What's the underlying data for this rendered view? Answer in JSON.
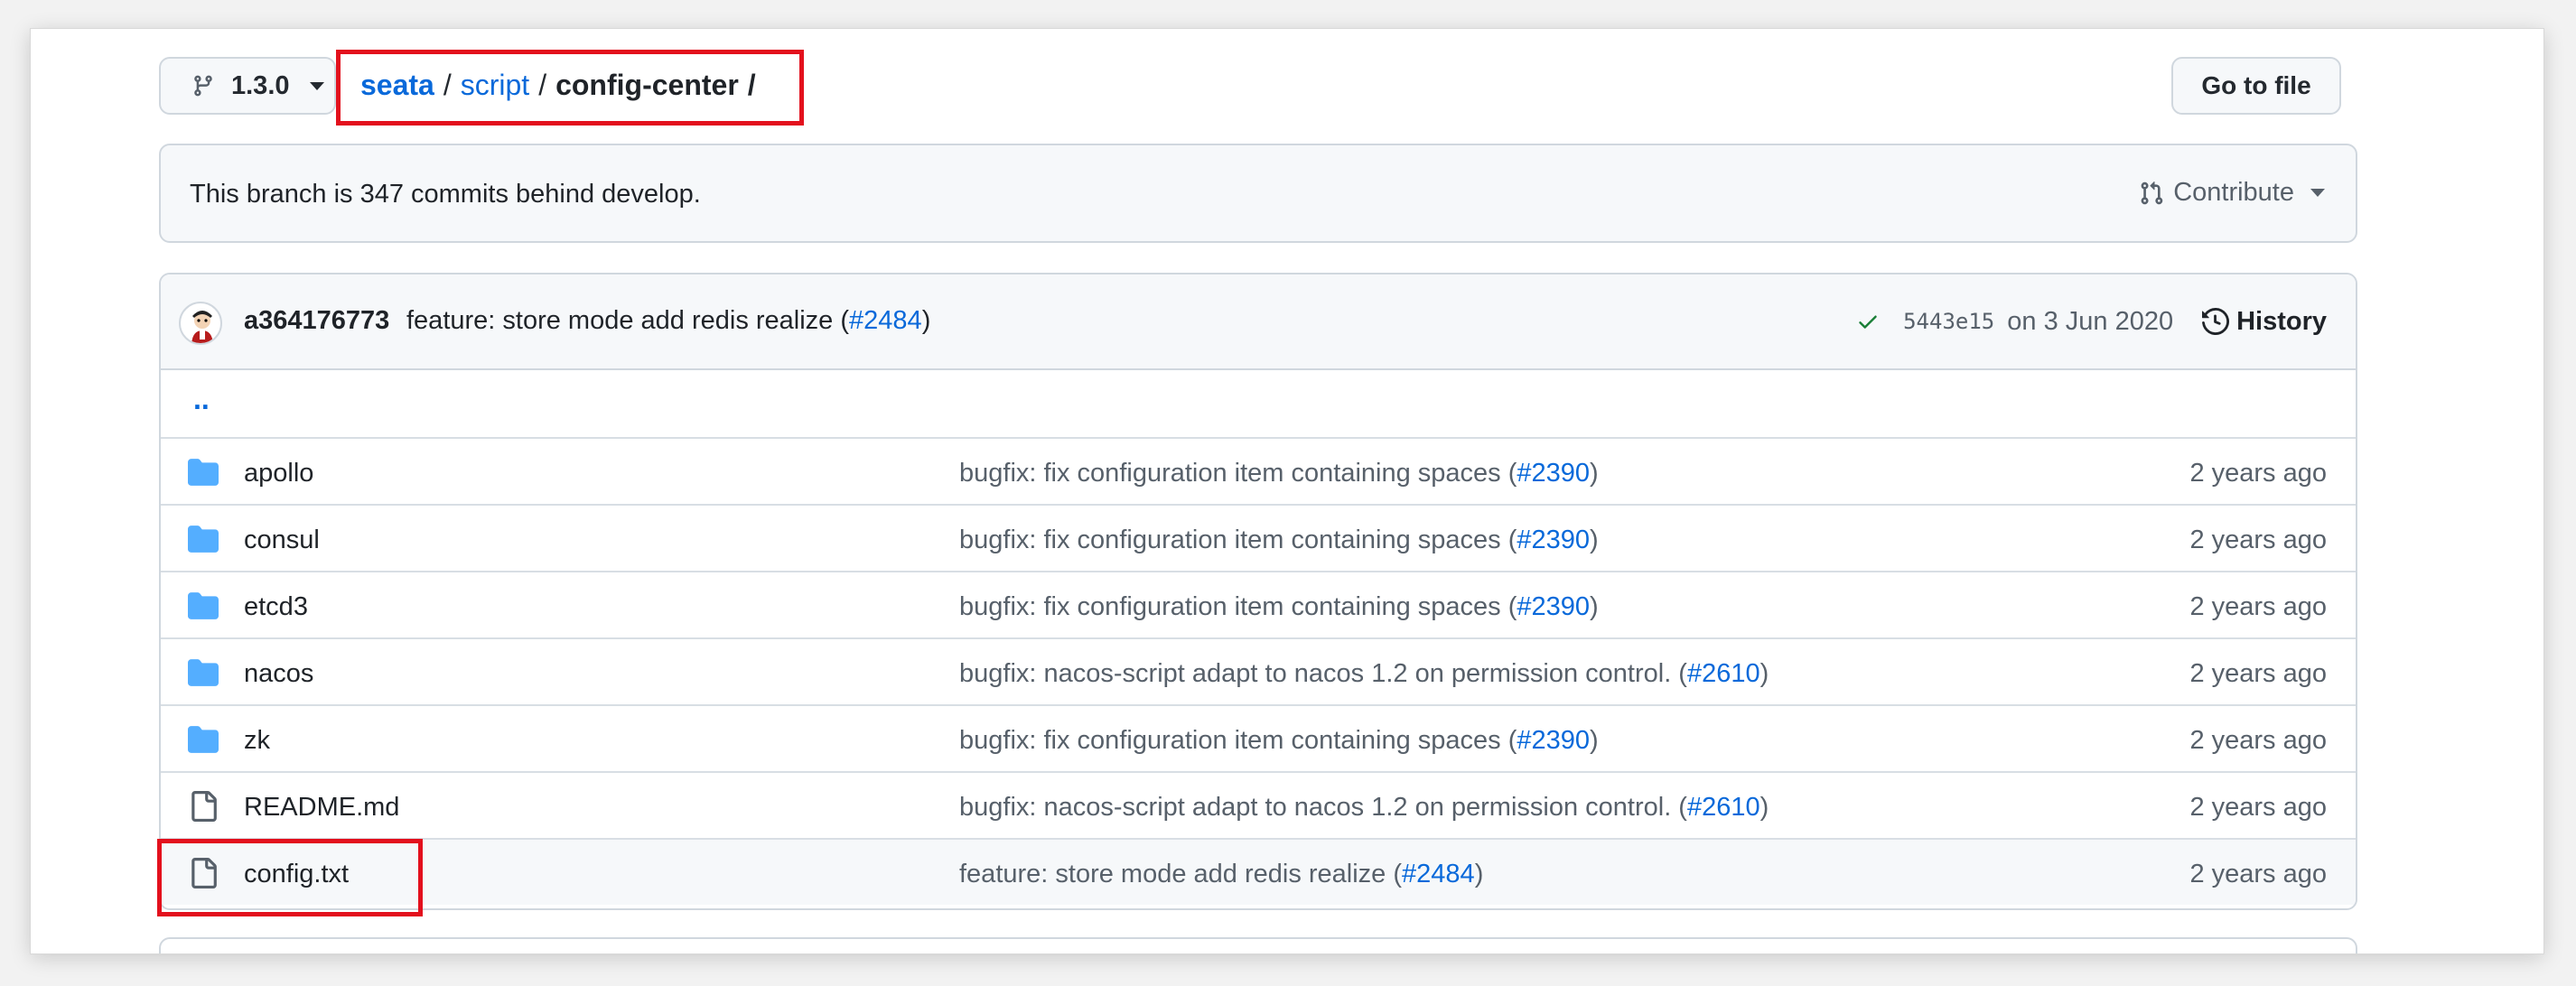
{
  "branch": {
    "name": "1.3.0"
  },
  "breadcrumb": {
    "repo": "seata",
    "folder": "script",
    "current": "config-center",
    "separator": "/"
  },
  "goto_file_label": "Go to file",
  "branch_info": {
    "message": "This branch is 347 commits behind develop.",
    "contribute_label": "Contribute"
  },
  "commit": {
    "author": "a364176773",
    "message": "feature: store mode add redis realize (",
    "pr": "#2484",
    "message_end": ")",
    "sha": "5443e15",
    "date": "on 3 Jun 2020",
    "history_label": "History"
  },
  "parent_link": "..",
  "files": [
    {
      "type": "folder",
      "name": "apollo",
      "message": "bugfix: fix configuration item containing spaces (",
      "pr": "#2390",
      "end": ")",
      "age": "2 years ago"
    },
    {
      "type": "folder",
      "name": "consul",
      "message": "bugfix: fix configuration item containing spaces (",
      "pr": "#2390",
      "end": ")",
      "age": "2 years ago"
    },
    {
      "type": "folder",
      "name": "etcd3",
      "message": "bugfix: fix configuration item containing spaces (",
      "pr": "#2390",
      "end": ")",
      "age": "2 years ago"
    },
    {
      "type": "folder",
      "name": "nacos",
      "message": "bugfix: nacos-script adapt to nacos 1.2 on permission control. (",
      "pr": "#2610",
      "end": ")",
      "age": "2 years ago"
    },
    {
      "type": "folder",
      "name": "zk",
      "message": "bugfix: fix configuration item containing spaces (",
      "pr": "#2390",
      "end": ")",
      "age": "2 years ago"
    },
    {
      "type": "file",
      "name": "README.md",
      "message": "bugfix: nacos-script adapt to nacos 1.2 on permission control. (",
      "pr": "#2610",
      "end": ")",
      "age": "2 years ago"
    },
    {
      "type": "file",
      "name": "config.txt",
      "message": "feature: store mode add redis realize (",
      "pr": "#2484",
      "end": ")",
      "age": "2 years ago"
    }
  ],
  "colors": {
    "link": "#0969da",
    "folder": "#54aeff",
    "highlight_box": "#e3101d",
    "check": "#1a7f37"
  }
}
